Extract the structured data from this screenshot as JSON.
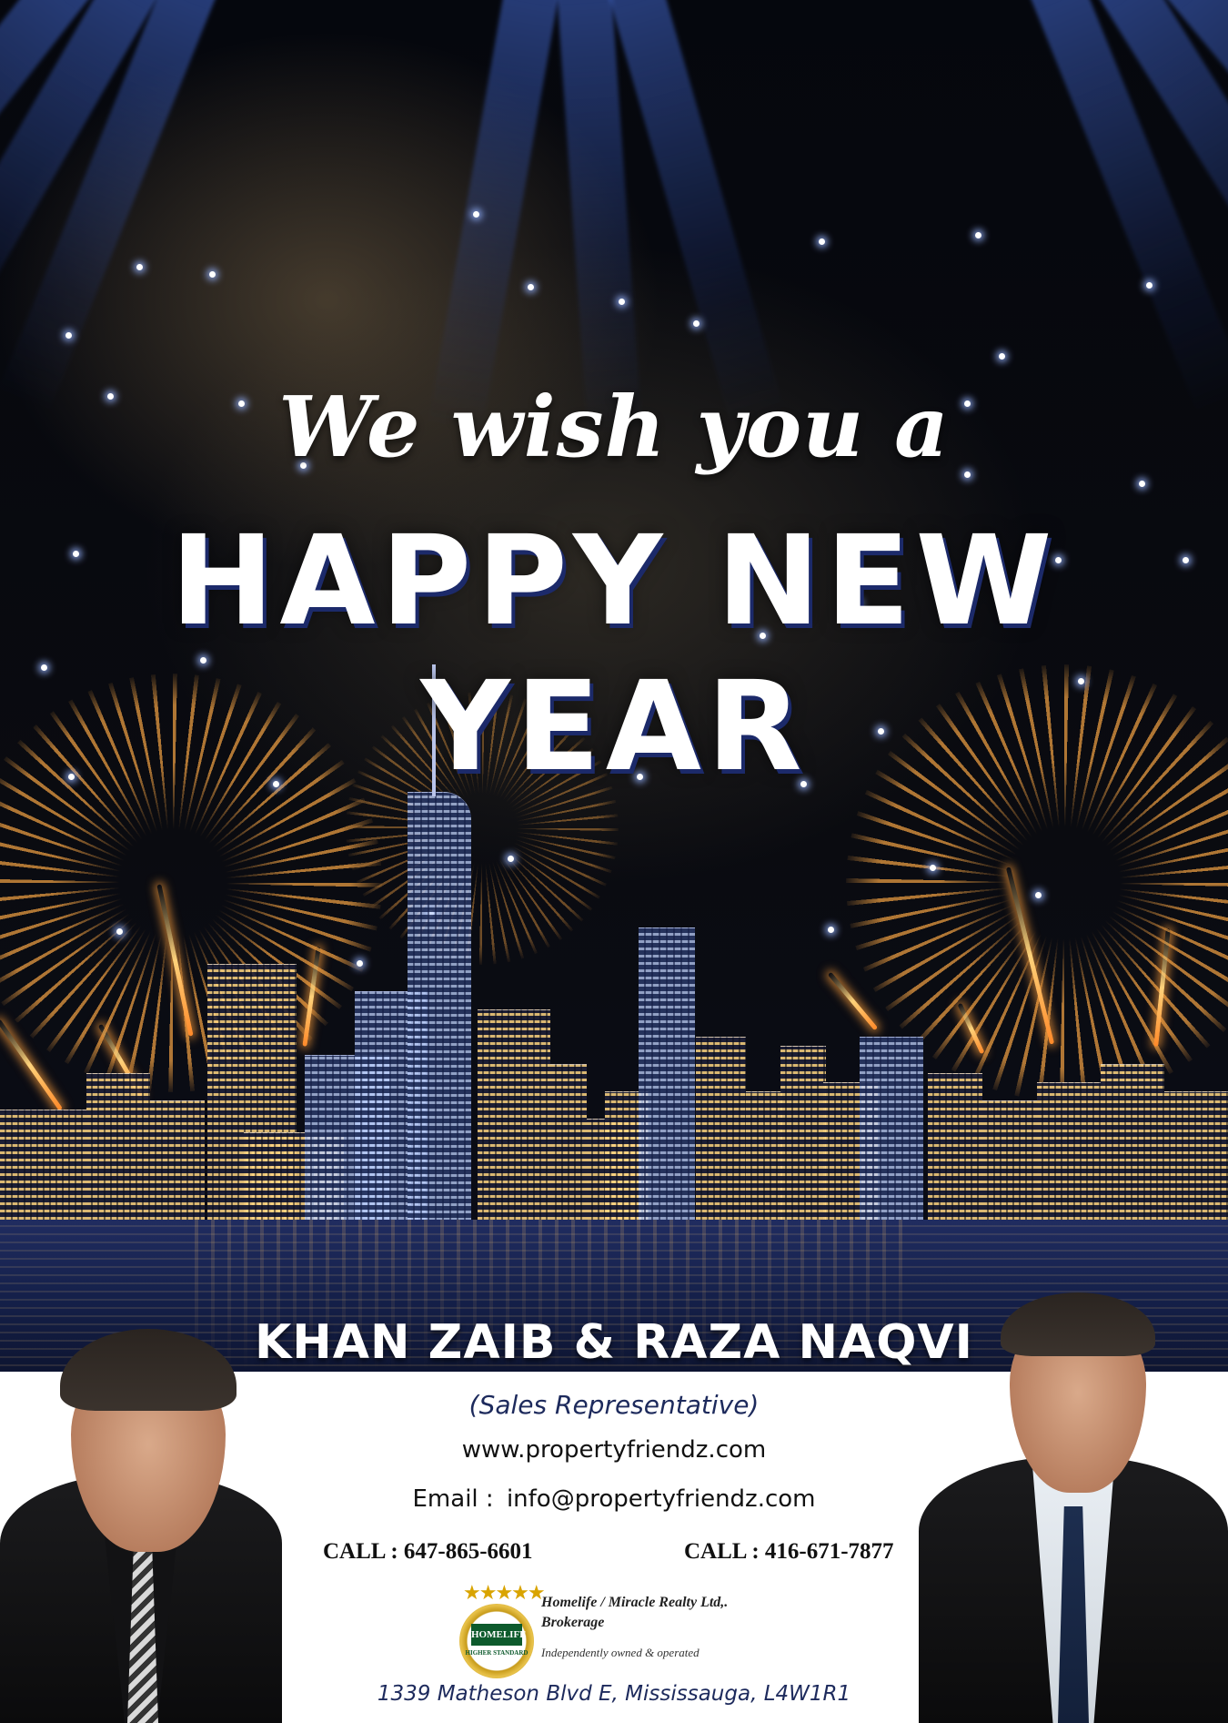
{
  "greeting": "We wish you a",
  "headline": {
    "line1": "HAPPY NEW",
    "line2": "YEAR"
  },
  "names": "KHAN ZAIB  & RAZA NAQVI",
  "title": "(Sales Representative)",
  "website": "www.propertyfriendz.com",
  "email": {
    "label": "Email :",
    "value": "info@propertyfriendz.com"
  },
  "calls": [
    "CALL : 647-865-6601",
    "CALL : 416-671-7877"
  ],
  "brokerage": {
    "name_line1": "Homelife / Miracle Realty Ltd,.",
    "name_line2": "Brokerage",
    "note": "Independently owned & operated",
    "logo_text": "HOMELIFE",
    "logo_sub": "HIGHER STANDARD"
  },
  "address": "1339 Matheson Blvd E, Mississauga, L4W1R1",
  "colors": {
    "accent_navy": "#1d2a5c",
    "headline_shadow": "#1c2a6a",
    "logo_gold": "#d9a400",
    "logo_green": "#0d5a2c"
  }
}
